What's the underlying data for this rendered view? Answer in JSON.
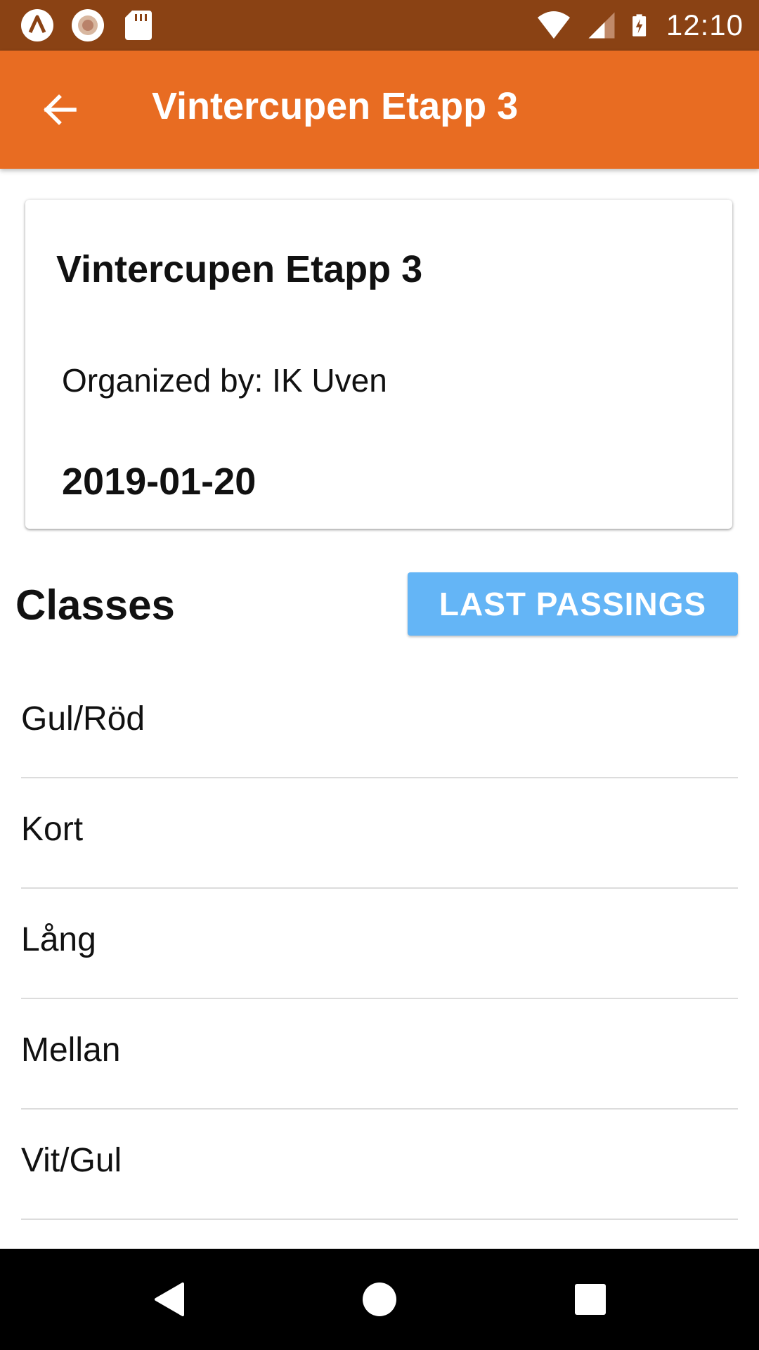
{
  "status_bar": {
    "left_icons": [
      "app-launcher-icon",
      "record-icon",
      "sd-card-icon"
    ],
    "right_icons": [
      "wifi-icon",
      "cell-signal-icon",
      "battery-charging-icon"
    ],
    "time": "12:10",
    "background": "#8a4214"
  },
  "app_bar": {
    "title": "Vintercupen Etapp 3",
    "back_icon": "arrow-back-icon",
    "color": "#e86c22"
  },
  "competition": {
    "name": "Vintercupen Etapp 3",
    "organizer": "Organized by: IK Uven",
    "date": "2019-01-20"
  },
  "classes_section": {
    "heading": "Classes",
    "button_label": "LAST PASSINGS",
    "button_color": "#64b5f6",
    "items": [
      {
        "label": "Gul/Röd"
      },
      {
        "label": "Kort"
      },
      {
        "label": "Lång"
      },
      {
        "label": "Mellan"
      },
      {
        "label": "Vit/Gul"
      }
    ]
  },
  "nav_bar": {
    "buttons": [
      "back-triangle-icon",
      "home-circle-icon",
      "recents-square-icon"
    ]
  }
}
